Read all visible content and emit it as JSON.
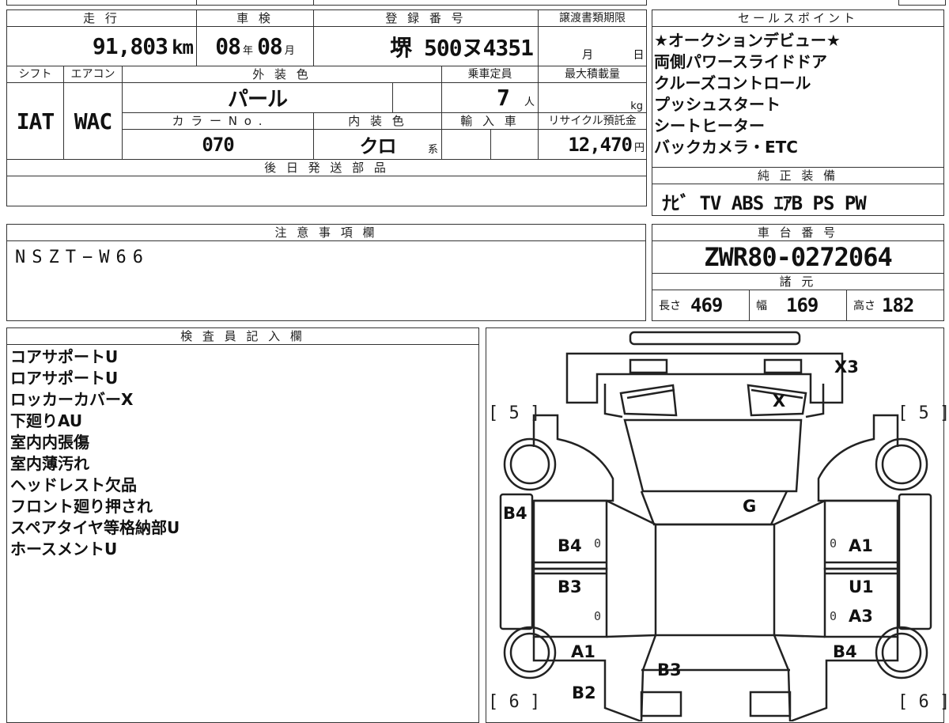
{
  "vehicle": {
    "mileage_header": "走 行",
    "mileage": "91,803",
    "mileage_unit": "km",
    "inspection_header": "車 検",
    "inspection_year": "08",
    "inspection_year_unit": "年",
    "inspection_month": "08",
    "inspection_month_unit": "月",
    "registration_header": "登 録 番 号",
    "registration": "堺 500ヌ4351",
    "transfer_header": "譲渡書類期限",
    "transfer_month": "月",
    "transfer_day": "日",
    "shift_header": "シフト",
    "shift": "IAT",
    "aircon_header": "エアコン",
    "aircon": "WAC",
    "exterior_header": "外 装 色",
    "exterior": "パール",
    "capacity_header": "乗車定員",
    "capacity": "7",
    "capacity_unit": "人",
    "maxload_header": "最大積載量",
    "maxload_unit": "kg",
    "color_no_header": "カ ラ ー N o .",
    "color_no": "070",
    "interior_header": "内 装 色",
    "interior": "クロ",
    "interior_unit": "系",
    "import_header": "輸 入 車",
    "recycle_header": "リサイクル預託金",
    "recycle": "12,470",
    "recycle_unit": "円",
    "later_parts_header": "後 日 発 送 部 品"
  },
  "sales_points": {
    "header": "セールスポイント",
    "items": [
      "★オークションデビュー★",
      "両側パワースライドドア",
      "クルーズコントロール",
      "プッシュスタート",
      "シートヒーター",
      "バックカメラ・ETC"
    ]
  },
  "equipment": {
    "header": "純 正 装 備",
    "value": "ﾅﾋﾞ TV ABS ｴｱB PS PW"
  },
  "notes": {
    "header": "注 意 事 項 欄",
    "value": "NSZT−W66"
  },
  "chassis": {
    "header": "車 台 番 号",
    "value": "ZWR80-0272064",
    "specs_header": "諸 元",
    "length_label": "長さ",
    "length": "469",
    "width_label": "幅",
    "width": "169",
    "height_label": "高さ",
    "height": "182"
  },
  "inspector": {
    "header": "検 査 員 記 入 欄",
    "items": [
      "コアサポートU",
      "ロアサポートU",
      "ロッカーカバーX",
      "下廻りAU",
      "室内内張傷",
      "室内薄汚れ",
      "ヘッドレスト欠品",
      "フロント廻り押され",
      "スペアタイヤ等格納部U",
      "ホースメントU"
    ]
  },
  "diagram": {
    "labels": {
      "x3": "X3",
      "x": "X",
      "g": "G",
      "b4_left": "B4",
      "b4_door": "B4",
      "a1_right": "A1",
      "b3_left": "B3",
      "u1_right": "U1",
      "a3_right": "A3",
      "a1_left": "A1",
      "b4_right": "B4",
      "b3_rear": "B3",
      "b2_left": "B2"
    },
    "tire_fl": "5",
    "tire_fr": "5",
    "tire_rl": "6",
    "tire_rr": "6",
    "zero": "0"
  }
}
